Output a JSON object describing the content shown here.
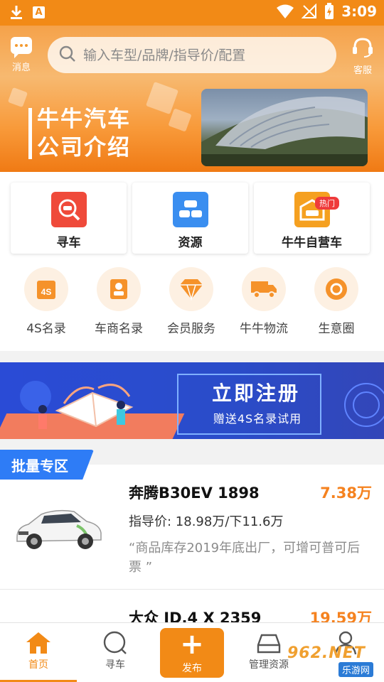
{
  "status_bar": {
    "time": "3:09",
    "a_letter": "A"
  },
  "header": {
    "messages_label": "消息",
    "search_placeholder": "输入车型/品牌/指导价/配置",
    "service_label": "客服"
  },
  "hero": {
    "line1": "牛牛汽车",
    "line2": "公司介绍",
    "photo_caption": ""
  },
  "quick_cards": [
    {
      "label": "寻车",
      "icon": "car-search-icon",
      "color": "#ef4a3a"
    },
    {
      "label": "资源",
      "icon": "cars-icon",
      "color": "#3a8ef0"
    },
    {
      "label": "牛牛自营车",
      "icon": "garage-icon",
      "color": "#f5a020",
      "badge": "热门"
    }
  ],
  "grid_items": [
    {
      "label": "4S名录",
      "icon": "4s-directory-icon",
      "icon_text": "4S"
    },
    {
      "label": "车商名录",
      "icon": "dealer-directory-icon"
    },
    {
      "label": "会员服务",
      "icon": "diamond-icon"
    },
    {
      "label": "牛牛物流",
      "icon": "truck-icon"
    },
    {
      "label": "生意圈",
      "icon": "circle-icon"
    }
  ],
  "register_banner": {
    "title": "立即注册",
    "subtitle": "赠送4S名录试用"
  },
  "section": {
    "title": "批量专区"
  },
  "listings": [
    {
      "name": "奔腾B30EV 1898",
      "price": "7.38万",
      "guide": "指导价: 18.98万/下11.6万",
      "note": "“商品库存2019年底出厂，可增可普可后票 ”"
    },
    {
      "name": "大众 ID.4 X 2359",
      "price": "19.59万",
      "guide": "",
      "note": ""
    }
  ],
  "bottom_nav": {
    "home": "首页",
    "find_car": "寻车",
    "publish": "发布",
    "manage": "管理资源",
    "mine": ""
  },
  "watermark": {
    "number": "962.NET",
    "sub": "乐游网"
  },
  "colors": {
    "brand_orange": "#f28a16",
    "price_orange": "#f5821f",
    "tag_blue": "#2e7cf6"
  }
}
